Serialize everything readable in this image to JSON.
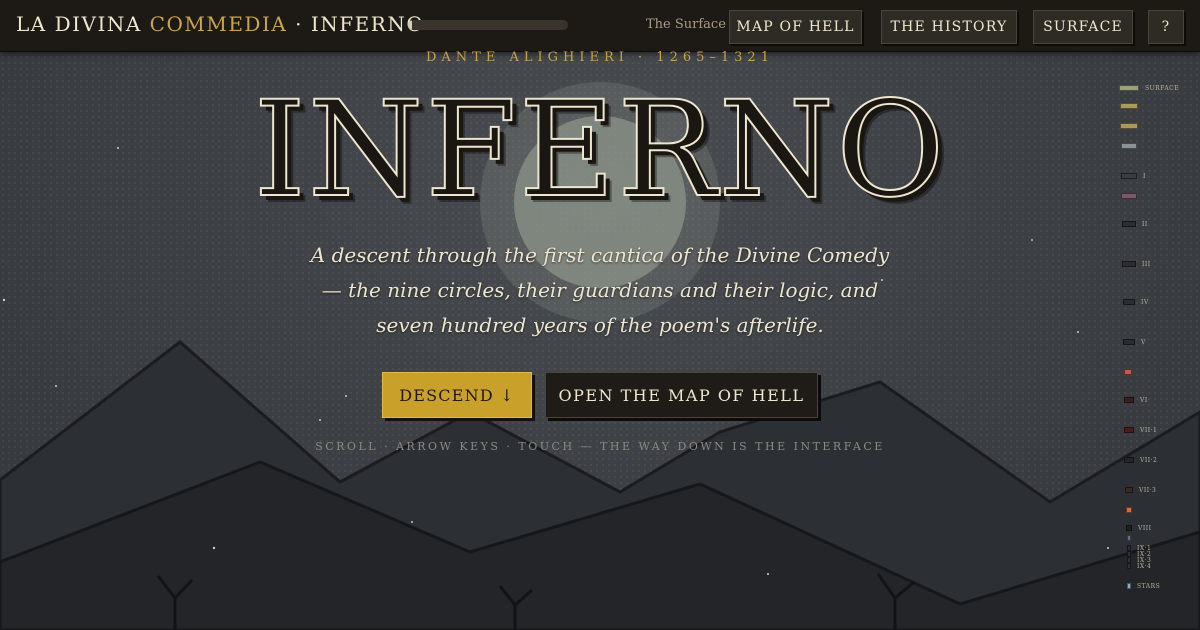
{
  "header": {
    "brand_part1": "LA DIVINA",
    "brand_accent": "COMMEDIA",
    "brand_part2": "· INFERNO",
    "progress_fraction": 0.02,
    "location_label": "The Surface",
    "nav": {
      "map_label": "MAP OF HELL",
      "history_label": "THE HISTORY",
      "surface_label": "SURFACE",
      "help_label": "?"
    }
  },
  "hero": {
    "author_line": "DANTE ALIGHIERI · 1265–1321",
    "title": "INFERNO",
    "tagline": "A descent through the first cantica of the Divine Comedy — the nine circles, their guardians and their logic, and seven hundred years of the poem's afterlife.",
    "descend_label": "DESCEND ↓",
    "map_label": "OPEN THE MAP OF HELL",
    "hint": "SCROLL · ARROW KEYS · TOUCH — THE WAY DOWN IS THE INTERFACE"
  },
  "colors": {
    "accent_gold": "#c9a44a",
    "button_gold": "#c9a02a",
    "ink": "#1a1713",
    "parchment": "#efe6cf"
  },
  "rail": {
    "items": [
      {
        "label": "SURFACE",
        "color": "#9aa07a"
      },
      {
        "label": "",
        "color": "#a89a5a"
      },
      {
        "label": "",
        "color": "#a89a5a"
      },
      {
        "label": "",
        "color": "#8a9298"
      },
      {
        "label": "I",
        "color": "#3a3d44"
      },
      {
        "label": "",
        "color": "#7a5a6a"
      },
      {
        "label": "II",
        "color": "#2a2c3a"
      },
      {
        "label": "III",
        "color": "#2a2e34"
      },
      {
        "label": "IV",
        "color": "#2c2e30"
      },
      {
        "label": "V",
        "color": "#2a2c30"
      },
      {
        "label": "",
        "color": "#c05a4a"
      },
      {
        "label": "VI",
        "color": "#3a2020"
      },
      {
        "label": "VII·1",
        "color": "#4a1c1c"
      },
      {
        "label": "VII·2",
        "color": "#22262c"
      },
      {
        "label": "VII·3",
        "color": "#3a2a24"
      },
      {
        "label": "",
        "color": "#d86a3a"
      },
      {
        "label": "VIII",
        "color": "#22201e"
      },
      {
        "label": "",
        "color": "#6a6e78"
      },
      {
        "label": "IX·1",
        "color": "#2a2e3a"
      },
      {
        "label": "IX·2",
        "color": "#2a2e3a"
      },
      {
        "label": "IX·3",
        "color": "#2a3040"
      },
      {
        "label": "IX·4",
        "color": "#2a3040"
      },
      {
        "label": "STARS",
        "color": "#8ab0c8"
      }
    ]
  }
}
